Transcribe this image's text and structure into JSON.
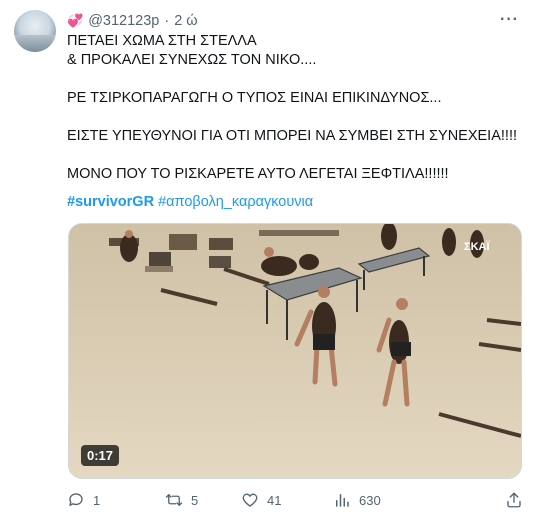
{
  "user": {
    "handle": "@312123p",
    "separator": "·",
    "time": "2 ώ",
    "emoji": "💞"
  },
  "post": {
    "lines": [
      "ΠΕΤΑΕΙ ΧΩΜΑ ΣΤΗ ΣΤΕΛΛΑ",
      "& ΠΡΟΚΑΛΕΙ ΣΥΝΕΧΩΣ ΤΟΝ ΝΙΚΟ....",
      "ΡΕ ΤΣΙΡΚΟΠΑΡΑΓΩΓΗ Ο ΤΥΠΟΣ ΕΙΝΑΙ ΕΠΙΚΙΝΔΥΝΟΣ...",
      "ΕΙΣΤΕ ΥΠΕΥΘΥΝΟΙ ΓΙΑ ΟΤΙ ΜΠΟΡΕΙ ΝΑ ΣΥΜΒΕΙ ΣΤΗ ΣΥΝΕΧΕΙΑ!!!!",
      "ΜΟΝΟ ΠΟΥ ΤΟ ΡΙΣΚΑΡΕΤΕ ΑΥΤΟ ΛΕΓΕΤΑΙ ΞΕΦΤΙΛΑ!!!!!!"
    ],
    "hashtag_1": "#survivorGR",
    "hashtag_2": "#αποβολη_καραγκουνια"
  },
  "media": {
    "duration": "0:17"
  },
  "actions": {
    "replies": "1",
    "reposts": "5",
    "likes": "41",
    "views": "630"
  },
  "colors": {
    "link": "#1d9bf0",
    "text": "#0f1419",
    "muted": "#536471"
  }
}
